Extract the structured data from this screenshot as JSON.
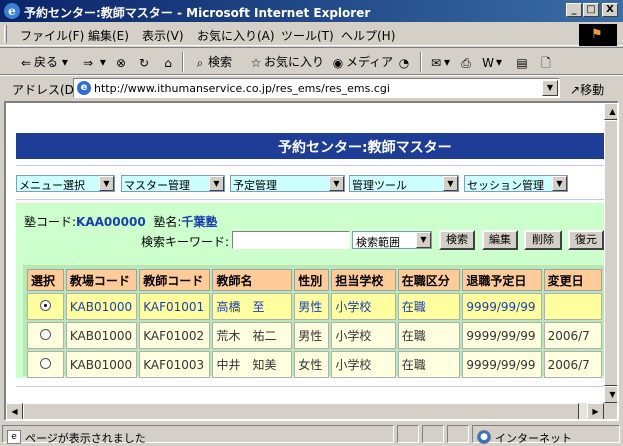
{
  "window": {
    "title": "予約センター:教師マスター - Microsoft Internet Explorer",
    "minimize": "_",
    "maximize": "□",
    "close": "X"
  },
  "menu": [
    "ファイル(F)",
    "編集(E)",
    "表示(V)",
    "お気に入り(A)",
    "ツール(T)",
    "ヘルプ(H)"
  ],
  "toolbar": {
    "back": "戻る",
    "search": "検索",
    "favorites": "お気に入り",
    "media": "メディア"
  },
  "address": {
    "label": "アドレス(D)",
    "url": "http://www.ithumanservice.co.jp/res_ems/res_ems.cgi",
    "go": "移動"
  },
  "page": {
    "header": "予約センター:教師マスター",
    "menus": [
      "メニュー選択",
      "マスター管理",
      "予定管理",
      "管理ツール",
      "セッション管理"
    ],
    "juku_code_label": "塾コード:",
    "juku_code": "KAA00000",
    "juku_name_label": "塾名:",
    "juku_name": "千葉塾",
    "keyword_label": "検索キーワード:",
    "keyword_value": "",
    "range": "検索範囲",
    "buttons": [
      "検索",
      "編集",
      "削除",
      "復元"
    ],
    "table": {
      "headers": [
        "選択",
        "教場コード",
        "教師コード",
        "教師名",
        "性別",
        "担当学校",
        "在職区分",
        "退職予定日",
        "変更日"
      ],
      "rows": [
        {
          "selected": true,
          "cells": [
            "KAB01000",
            "KAF01001",
            "高橋　至",
            "男性",
            "小学校",
            "在職",
            "9999/99/99",
            ""
          ]
        },
        {
          "selected": false,
          "cells": [
            "KAB01000",
            "KAF01002",
            "荒木　祐二",
            "男性",
            "小学校",
            "在職",
            "9999/99/99",
            "2006/7"
          ]
        },
        {
          "selected": false,
          "cells": [
            "KAB01000",
            "KAF01003",
            "中井　知美",
            "女性",
            "小学校",
            "在職",
            "9999/99/99",
            "2006/7"
          ]
        }
      ]
    }
  },
  "status": {
    "text": "ページが表示されました",
    "zone": "インターネット"
  }
}
